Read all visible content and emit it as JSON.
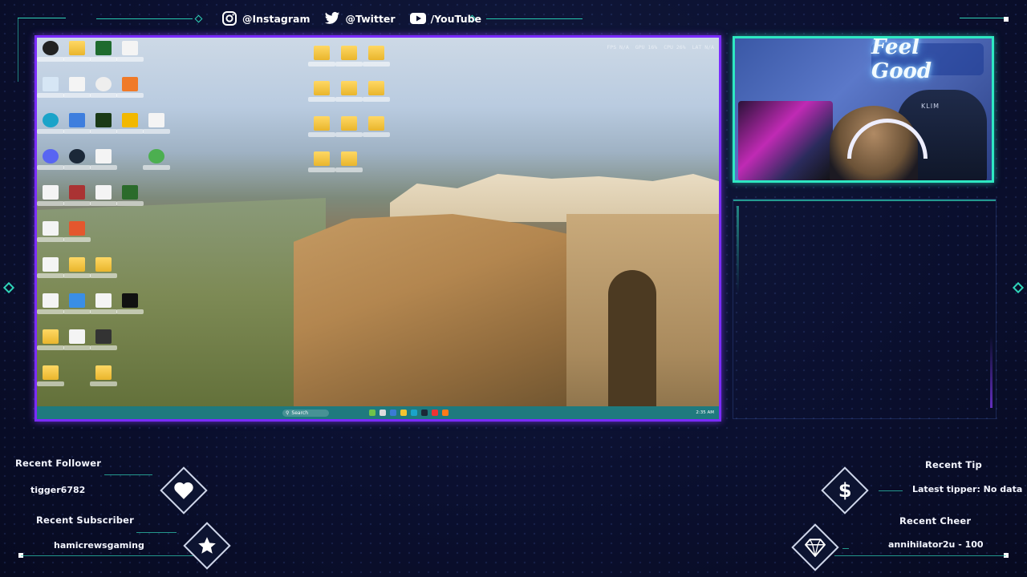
{
  "socials": {
    "instagram": {
      "icon": "instagram-icon",
      "label": "@Instagram"
    },
    "twitter": {
      "icon": "twitter-icon",
      "label": "@Twitter"
    },
    "youtube": {
      "icon": "youtube-icon",
      "label": "/YouTube"
    }
  },
  "desktop": {
    "hud": {
      "fps": "FPS N/A",
      "gpu": "GPU 16%",
      "cpu": "CPU 26%",
      "lat": "LAT N/A"
    },
    "taskbar": {
      "search_placeholder": "Search",
      "time": "2:35 AM"
    }
  },
  "webcam": {
    "neon_sign": "Feel Good",
    "chair_brand": "KLIM"
  },
  "alerts": {
    "recent_follower": {
      "title": "Recent Follower",
      "value": "tigger6782",
      "icon": "heart-icon"
    },
    "recent_subscriber": {
      "title": "Recent Subscriber",
      "value": "hamicrewsgaming",
      "icon": "star-icon"
    },
    "recent_tip": {
      "title": "Recent Tip",
      "value": "Latest tipper: No data",
      "icon": "dollar-icon"
    },
    "recent_cheer": {
      "title": "Recent Cheer",
      "value": "annihilator2u - 100",
      "icon": "diamond-icon"
    }
  },
  "colors": {
    "accent_teal": "#2fd3b8",
    "screen_border": "#7a2cff",
    "cam_border": "#2ee8c2"
  }
}
